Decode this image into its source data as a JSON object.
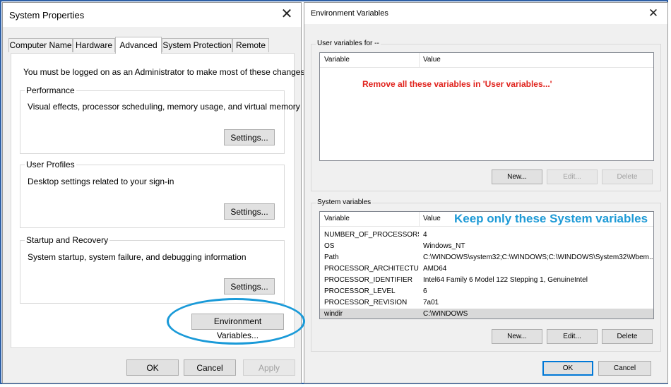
{
  "system_properties": {
    "title": "System Properties",
    "tabs": [
      "Computer Name",
      "Hardware",
      "Advanced",
      "System Protection",
      "Remote"
    ],
    "active_tab": "Advanced",
    "admin_notice": "You must be logged on as an Administrator to make most of these changes.",
    "performance": {
      "label": "Performance",
      "description": "Visual effects, processor scheduling, memory usage, and virtual memory",
      "settings_label": "Settings..."
    },
    "user_profiles": {
      "label": "User Profiles",
      "description": "Desktop settings related to your sign-in",
      "settings_label": "Settings..."
    },
    "startup_recovery": {
      "label": "Startup and Recovery",
      "description": "System startup, system failure, and debugging information",
      "settings_label": "Settings..."
    },
    "env_vars_label": "Environment Variables...",
    "ok_label": "OK",
    "cancel_label": "Cancel",
    "apply_label": "Apply"
  },
  "environment_variables": {
    "title": "Environment Variables",
    "user_group_label": "User variables for --",
    "user_header_variable": "Variable",
    "user_header_value": "Value",
    "user_new": "New...",
    "user_edit": "Edit...",
    "user_delete": "Delete",
    "system_group_label": "System variables",
    "system_header_variable": "Variable",
    "system_header_value": "Value",
    "system_rows": [
      {
        "variable": "NUMBER_OF_PROCESSORS",
        "value": "4"
      },
      {
        "variable": "OS",
        "value": "Windows_NT"
      },
      {
        "variable": "Path",
        "value": "C:\\WINDOWS\\system32;C:\\WINDOWS;C:\\WINDOWS\\System32\\Wbem..."
      },
      {
        "variable": "PROCESSOR_ARCHITECTURE",
        "value": "AMD64"
      },
      {
        "variable": "PROCESSOR_IDENTIFIER",
        "value": "Intel64 Family 6 Model 122 Stepping 1, GenuineIntel"
      },
      {
        "variable": "PROCESSOR_LEVEL",
        "value": "6"
      },
      {
        "variable": "PROCESSOR_REVISION",
        "value": "7a01"
      },
      {
        "variable": "windir",
        "value": "C:\\WINDOWS"
      }
    ],
    "system_new": "New...",
    "system_edit": "Edit...",
    "system_delete": "Delete",
    "ok_label": "OK",
    "cancel_label": "Cancel"
  },
  "annotations": {
    "user_note": "Remove all these variables in 'User variables...'",
    "system_note": "Keep only these System variables"
  },
  "colors": {
    "annotation_red": "#e0221c",
    "annotation_blue": "#1e9ad6",
    "focus_blue": "#0078d7"
  }
}
